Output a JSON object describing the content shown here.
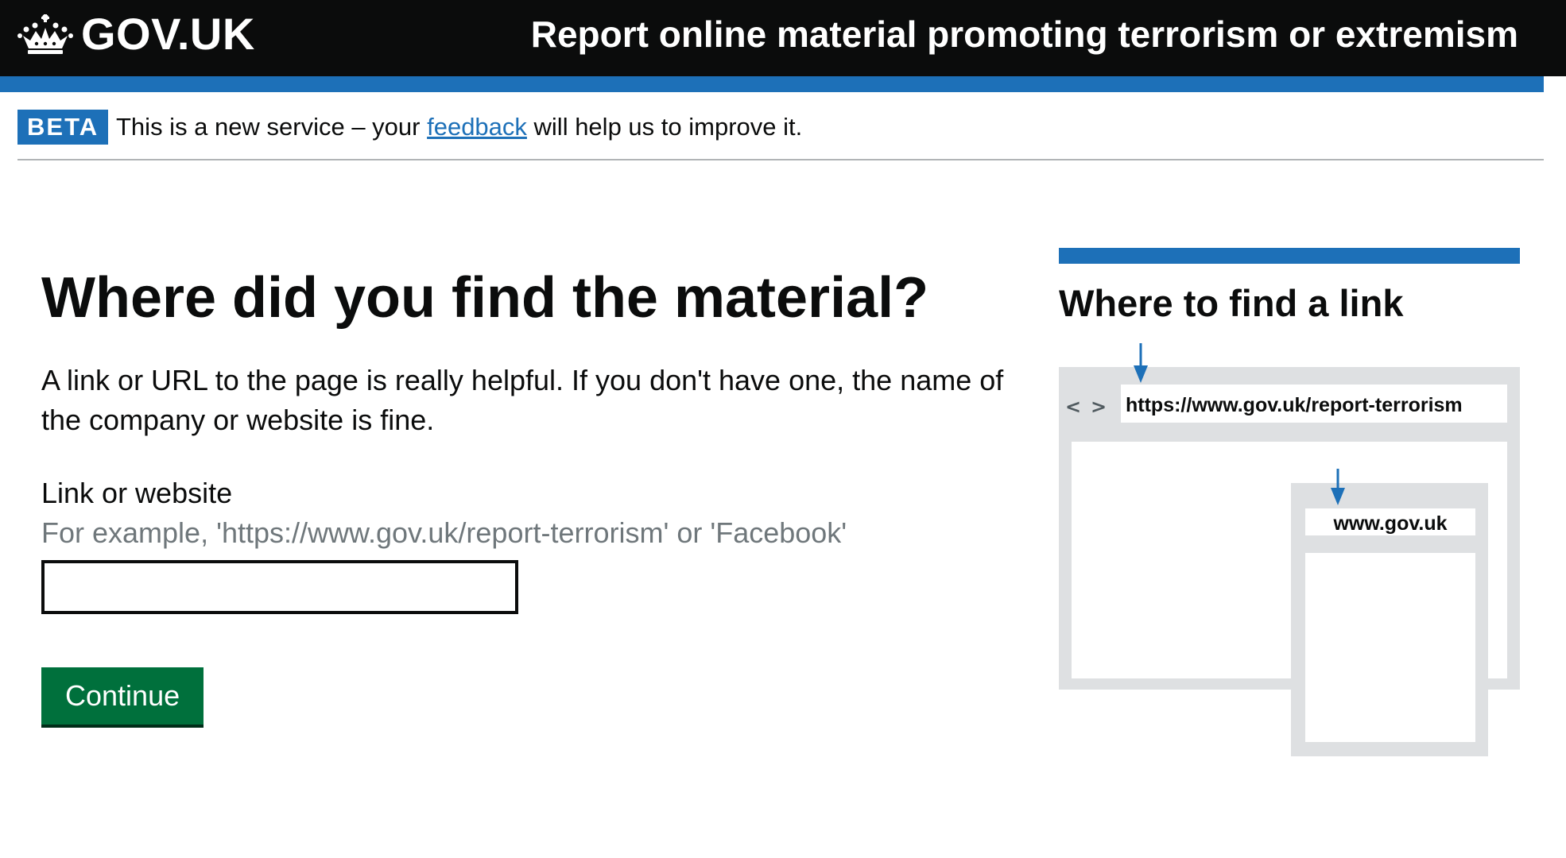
{
  "header": {
    "logo_text": "GOV.UK",
    "service_name": "Report online material promoting terrorism or extremism"
  },
  "phase_banner": {
    "tag": "BETA",
    "text_before": "This is a new service – your ",
    "link_text": "feedback",
    "text_after": " will help us to improve it."
  },
  "main": {
    "heading": "Where did you find the material?",
    "intro": "A link or URL to the page is really helpful. If you don't have one, the name of the company or website is fine.",
    "field": {
      "label": "Link or website",
      "hint": "For example, 'https://www.gov.uk/report-terrorism' or 'Facebook'",
      "value": ""
    },
    "continue_label": "Continue"
  },
  "aside": {
    "title": "Where to find a link",
    "nav_back": "<",
    "nav_forward": ">",
    "desktop_url": "https://www.gov.uk/report-terrorism",
    "mobile_url": "www.gov.uk"
  },
  "colors": {
    "header_bg": "#0b0c0c",
    "brand_blue": "#1d70b8",
    "button_green": "#00703c",
    "hint_grey": "#6f777b",
    "illustration_grey": "#dee0e2"
  }
}
